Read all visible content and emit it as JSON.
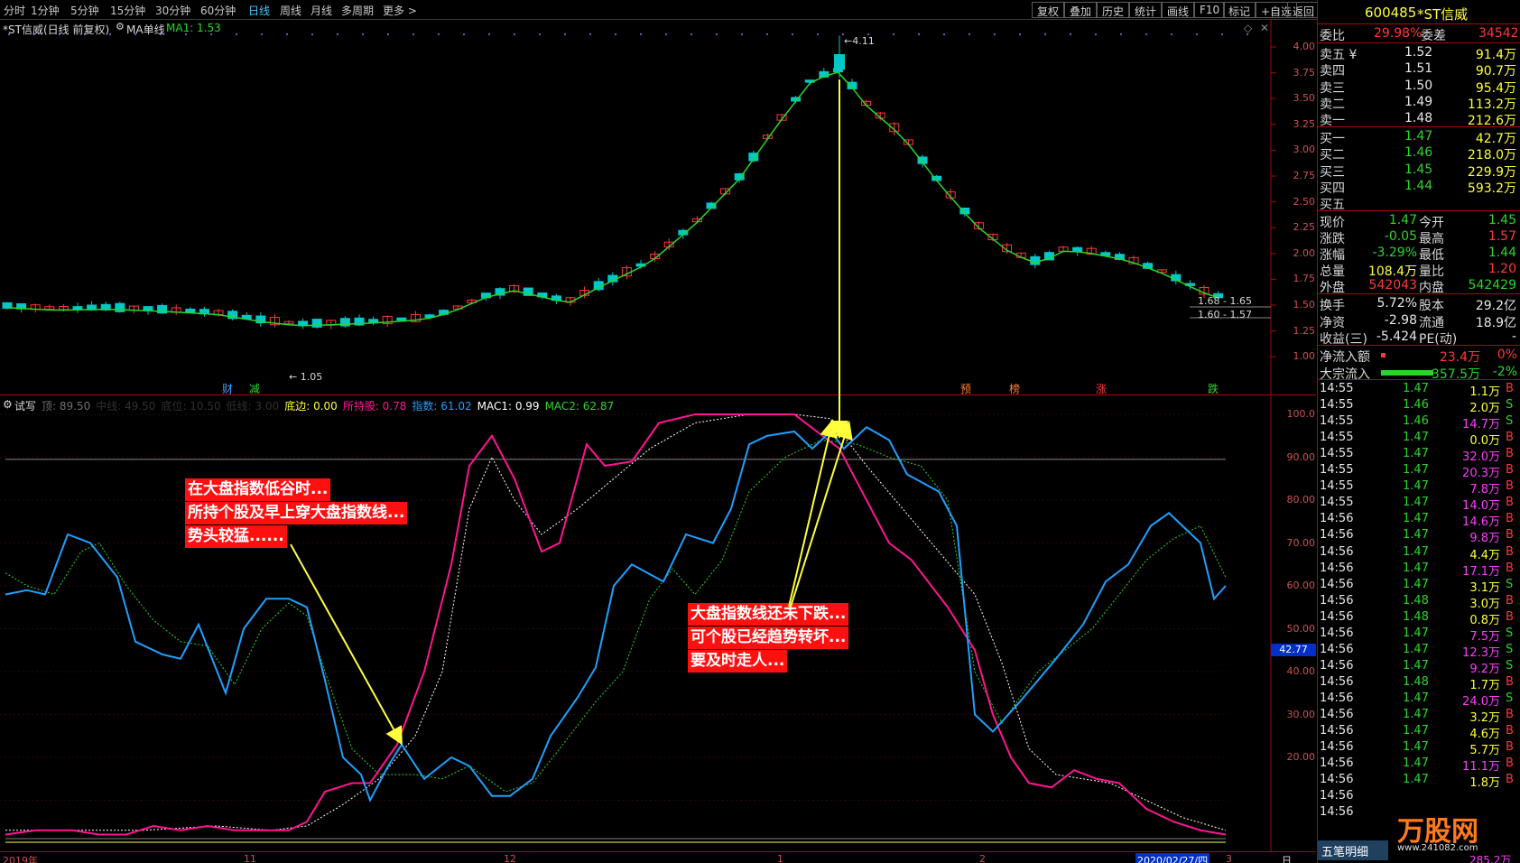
{
  "toolbar": {
    "periods": [
      "分时",
      "1分钟",
      "5分钟",
      "15分钟",
      "30分钟",
      "60分钟",
      "日线",
      "周线",
      "月线",
      "多周期",
      "更多 >"
    ],
    "active_period": "日线",
    "buttons": [
      "复权",
      "叠加",
      "历史",
      "统计",
      "画线",
      "F10",
      "标记",
      "+自选",
      "返回"
    ]
  },
  "main_chart": {
    "title": "*ST信威(日线 前复权)",
    "indicator": "MA单线",
    "ma1_label": "MA1: 1.53",
    "high_label": "4.11",
    "low_label": "1.05",
    "range_label_1": "1.68 - 1.65",
    "range_label_2": "1.60 - 1.57",
    "yticks": [
      "4.00",
      "3.75",
      "3.50",
      "3.25",
      "3.00",
      "2.75",
      "2.50",
      "2.25",
      "2.00",
      "1.75",
      "1.50",
      "1.25",
      "1.00"
    ],
    "markers": [
      {
        "text": "财",
        "color": "#3fa0ff"
      },
      {
        "text": "减",
        "color": "#2ad62a"
      },
      {
        "text": "预",
        "color": "#ff8030"
      },
      {
        "text": "榜",
        "color": "#ff8030"
      },
      {
        "text": "涨",
        "color": "#ff3838"
      },
      {
        "text": "跌",
        "color": "#2ad62a"
      }
    ]
  },
  "indicator_chart": {
    "name": "试写",
    "legend": [
      {
        "text": "顶: 89.50",
        "color": "#707070"
      },
      {
        "text": "中线: 49.50",
        "color": "#303030"
      },
      {
        "text": "底位: 10.50",
        "color": "#303030"
      },
      {
        "text": "低线: 3.00",
        "color": "#303030"
      },
      {
        "text": "底边: 0.00",
        "color": "#ffff3c"
      },
      {
        "text": "所持股: 0.78",
        "color": "#ff1493"
      },
      {
        "text": "指数: 61.02",
        "color": "#1ea0ff"
      },
      {
        "text": "MAC1: 0.99",
        "color": "#ffffff"
      },
      {
        "text": "MAC2: 62.87",
        "color": "#2ad62a"
      }
    ],
    "yticks": [
      "100.0",
      "90.00",
      "80.00",
      "70.00",
      "60.00",
      "50.00",
      "40.00",
      "30.00",
      "20.00"
    ],
    "current_value": "42.77",
    "annotation_1": [
      "在大盘指数低谷时...",
      "所持个股及早上穿大盘指数线...",
      "势头较猛......"
    ],
    "annotation_2": [
      "大盘指数线还未下跌...",
      "可个股已经趋势转坏...",
      "要及时走人..."
    ]
  },
  "bottom_axis": {
    "labels": [
      "2019年",
      "11",
      "12",
      "1",
      "2",
      "2020/02/27/四",
      "3"
    ],
    "corner": "日"
  },
  "panel": {
    "code": "600485",
    "name": "*ST信威",
    "weibi_label": "委比",
    "weibi": "29.98%",
    "weicha_label": "委差",
    "weicha": "34542",
    "asks": [
      {
        "label": "卖五 ¥",
        "price": "1.52",
        "vol": "91.4万"
      },
      {
        "label": "卖四",
        "price": "1.51",
        "vol": "90.7万"
      },
      {
        "label": "卖三",
        "price": "1.50",
        "vol": "95.4万"
      },
      {
        "label": "卖二",
        "price": "1.49",
        "vol": "113.2万"
      },
      {
        "label": "卖一",
        "price": "1.48",
        "vol": "212.6万"
      }
    ],
    "bids": [
      {
        "label": "买一",
        "price": "1.47",
        "vol": "42.7万"
      },
      {
        "label": "买二",
        "price": "1.46",
        "vol": "218.0万"
      },
      {
        "label": "买三",
        "price": "1.45",
        "vol": "229.9万"
      },
      {
        "label": "买四",
        "price": "1.44",
        "vol": "593.2万"
      },
      {
        "label": "买五",
        "price": "",
        "vol": ""
      }
    ],
    "stats": [
      {
        "l1": "现价",
        "v1": "1.47",
        "c1": "green",
        "l2": "今开",
        "v2": "1.45",
        "c2": "green"
      },
      {
        "l1": "涨跌",
        "v1": "-0.05",
        "c1": "green",
        "l2": "最高",
        "v2": "1.57",
        "c2": "red"
      },
      {
        "l1": "涨幅",
        "v1": "-3.29%",
        "c1": "green",
        "l2": "最低",
        "v2": "1.44",
        "c2": "green"
      },
      {
        "l1": "总量",
        "v1": "108.4万",
        "c1": "yellow",
        "l2": "量比",
        "v2": "1.20",
        "c2": "red"
      },
      {
        "l1": "外盘",
        "v1": "542043",
        "c1": "red",
        "l2": "内盘",
        "v2": "542429",
        "c2": "green"
      }
    ],
    "stats2": [
      {
        "l1": "换手",
        "v1": "5.72%",
        "c1": "white",
        "l2": "股本",
        "v2": "29.2亿",
        "c2": "white"
      },
      {
        "l1": "净资",
        "v1": "-2.98",
        "c1": "white",
        "l2": "流通",
        "v2": "18.9亿",
        "c2": "white"
      },
      {
        "l1": "收益(三)",
        "v1": "-5.424",
        "c1": "white",
        "l2": "PE(动)",
        "v2": "-",
        "c2": "white"
      }
    ],
    "flow": [
      {
        "label": "净流入额",
        "value": "23.4万",
        "pct": "0%",
        "color": "red"
      },
      {
        "label": "大宗流入",
        "value": "-357.5万",
        "pct": "-2%",
        "color": "green"
      }
    ],
    "ticks": [
      {
        "t": "14:55",
        "p": "1.47",
        "v": "1.1万",
        "bs": "B",
        "pc": "green",
        "vc": "yellow"
      },
      {
        "t": "14:55",
        "p": "1.46",
        "v": "2.0万",
        "bs": "S",
        "pc": "green",
        "vc": "yellow"
      },
      {
        "t": "14:55",
        "p": "1.46",
        "v": "14.7万",
        "bs": "S",
        "pc": "green",
        "vc": "magenta"
      },
      {
        "t": "14:55",
        "p": "1.47",
        "v": "0.0万",
        "bs": "B",
        "pc": "green",
        "vc": "yellow"
      },
      {
        "t": "14:55",
        "p": "1.47",
        "v": "32.0万",
        "bs": "B",
        "pc": "green",
        "vc": "magenta"
      },
      {
        "t": "14:55",
        "p": "1.47",
        "v": "20.3万",
        "bs": "B",
        "pc": "green",
        "vc": "magenta"
      },
      {
        "t": "14:55",
        "p": "1.47",
        "v": "7.8万",
        "bs": "B",
        "pc": "green",
        "vc": "magenta"
      },
      {
        "t": "14:55",
        "p": "1.47",
        "v": "14.0万",
        "bs": "B",
        "pc": "green",
        "vc": "magenta"
      },
      {
        "t": "14:56",
        "p": "1.47",
        "v": "14.6万",
        "bs": "B",
        "pc": "green",
        "vc": "magenta"
      },
      {
        "t": "14:56",
        "p": "1.47",
        "v": "9.8万",
        "bs": "B",
        "pc": "green",
        "vc": "magenta"
      },
      {
        "t": "14:56",
        "p": "1.47",
        "v": "4.4万",
        "bs": "B",
        "pc": "green",
        "vc": "yellow"
      },
      {
        "t": "14:56",
        "p": "1.47",
        "v": "17.1万",
        "bs": "B",
        "pc": "green",
        "vc": "magenta"
      },
      {
        "t": "14:56",
        "p": "1.47",
        "v": "3.1万",
        "bs": "S",
        "pc": "green",
        "vc": "yellow"
      },
      {
        "t": "14:56",
        "p": "1.48",
        "v": "3.0万",
        "bs": "B",
        "pc": "green",
        "vc": "yellow"
      },
      {
        "t": "14:56",
        "p": "1.48",
        "v": "0.8万",
        "bs": "B",
        "pc": "green",
        "vc": "yellow"
      },
      {
        "t": "14:56",
        "p": "1.47",
        "v": "7.5万",
        "bs": "S",
        "pc": "green",
        "vc": "magenta"
      },
      {
        "t": "14:56",
        "p": "1.47",
        "v": "12.3万",
        "bs": "S",
        "pc": "green",
        "vc": "magenta"
      },
      {
        "t": "14:56",
        "p": "1.47",
        "v": "9.2万",
        "bs": "S",
        "pc": "green",
        "vc": "magenta"
      },
      {
        "t": "14:56",
        "p": "1.48",
        "v": "1.7万",
        "bs": "B",
        "pc": "green",
        "vc": "yellow"
      },
      {
        "t": "14:56",
        "p": "1.47",
        "v": "24.0万",
        "bs": "S",
        "pc": "green",
        "vc": "magenta"
      },
      {
        "t": "14:56",
        "p": "1.47",
        "v": "3.2万",
        "bs": "B",
        "pc": "green",
        "vc": "yellow"
      },
      {
        "t": "14:56",
        "p": "1.47",
        "v": "4.6万",
        "bs": "B",
        "pc": "green",
        "vc": "yellow"
      },
      {
        "t": "14:56",
        "p": "1.47",
        "v": "5.7万",
        "bs": "B",
        "pc": "green",
        "vc": "yellow"
      },
      {
        "t": "14:56",
        "p": "1.47",
        "v": "11.1万",
        "bs": "B",
        "pc": "green",
        "vc": "magenta"
      },
      {
        "t": "14:56",
        "p": "1.47",
        "v": "1.8万",
        "bs": "B",
        "pc": "green",
        "vc": "yellow"
      },
      {
        "t": "14:56",
        "p": "",
        "v": "",
        "bs": "",
        "pc": "green",
        "vc": "yellow"
      },
      {
        "t": "14:56",
        "p": "",
        "v": "",
        "bs": "",
        "pc": "green",
        "vc": "yellow"
      }
    ],
    "bottom_tab": "五笔明细",
    "watermark": "万股网",
    "watermark_sub": "www.241082.com",
    "last_vol": "285.2万"
  }
}
